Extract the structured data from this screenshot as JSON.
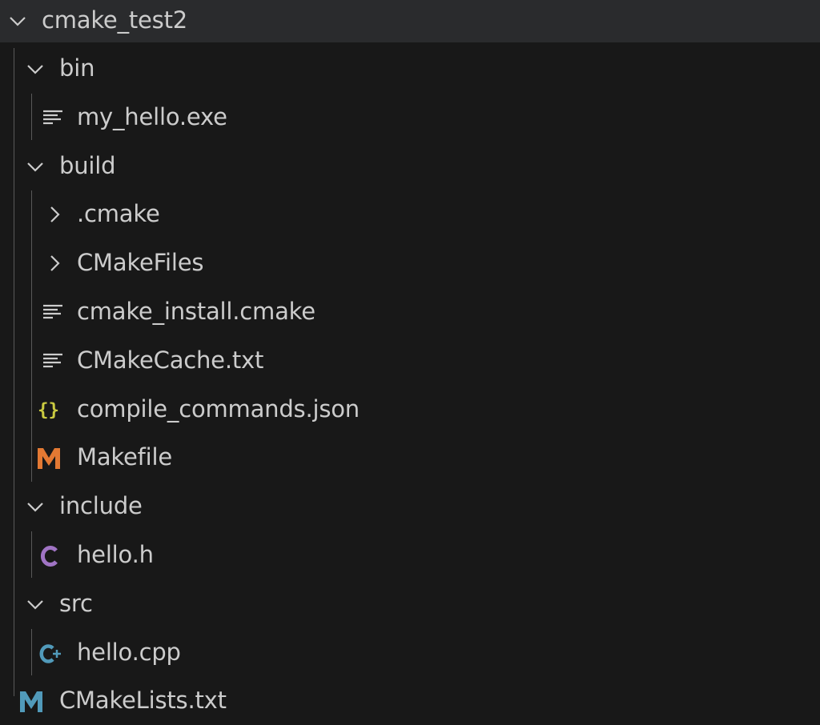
{
  "explorer": {
    "root": {
      "label": "cmake_test2",
      "icon": "chevron-down-icon"
    },
    "bin": {
      "label": "bin",
      "icon": "chevron-down-icon",
      "children": [
        {
          "label": "my_hello.exe",
          "icon": "text-file-icon"
        }
      ]
    },
    "build": {
      "label": "build",
      "icon": "chevron-down-icon",
      "children": [
        {
          "label": ".cmake",
          "icon": "chevron-right-icon"
        },
        {
          "label": "CMakeFiles",
          "icon": "chevron-right-icon"
        },
        {
          "label": "cmake_install.cmake",
          "icon": "text-file-icon"
        },
        {
          "label": "CMakeCache.txt",
          "icon": "text-file-icon"
        },
        {
          "label": "compile_commands.json",
          "icon": "json-braces-icon"
        },
        {
          "label": "Makefile",
          "icon": "makefile-m-icon"
        }
      ]
    },
    "include": {
      "label": "include",
      "icon": "chevron-down-icon",
      "children": [
        {
          "label": "hello.h",
          "icon": "c-header-icon"
        }
      ]
    },
    "src": {
      "label": "src",
      "icon": "chevron-down-icon",
      "children": [
        {
          "label": "hello.cpp",
          "icon": "cpp-file-icon"
        }
      ]
    },
    "top_files": [
      {
        "label": "CMakeLists.txt",
        "icon": "cmake-m-icon"
      }
    ]
  },
  "colors": {
    "background": "#181818",
    "header_background": "#2a2b2d",
    "text": "#cccccc",
    "json_icon": "#cbcb41",
    "makefile_icon": "#e37933",
    "c_icon": "#a074c4",
    "cpp_icon": "#519aba",
    "cmake_icon": "#519aba"
  }
}
